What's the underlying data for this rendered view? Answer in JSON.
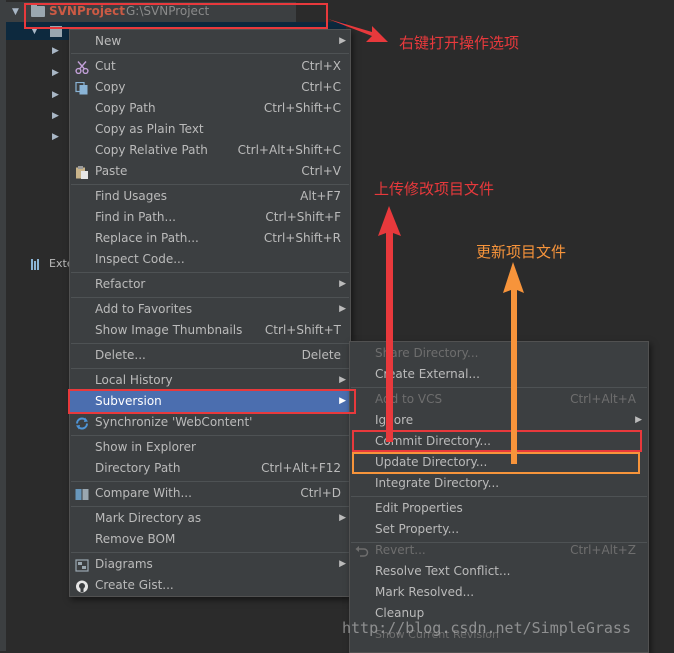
{
  "project": {
    "name": "SVNProject",
    "path": "G:\\SVNProject",
    "ext_label": "Exte"
  },
  "context_menu": {
    "items": [
      {
        "label": "New",
        "shortcut": "",
        "submenu": true
      },
      {
        "label": "Cut",
        "shortcut": "Ctrl+X",
        "icon": "scissors-icon"
      },
      {
        "label": "Copy",
        "shortcut": "Ctrl+C",
        "icon": "copy-icon"
      },
      {
        "label": "Copy Path",
        "shortcut": "Ctrl+Shift+C"
      },
      {
        "label": "Copy as Plain Text",
        "shortcut": ""
      },
      {
        "label": "Copy Relative Path",
        "shortcut": "Ctrl+Alt+Shift+C"
      },
      {
        "label": "Paste",
        "shortcut": "Ctrl+V",
        "icon": "clipboard-icon"
      },
      {
        "label": "Find Usages",
        "shortcut": "Alt+F7"
      },
      {
        "label": "Find in Path...",
        "shortcut": "Ctrl+Shift+F"
      },
      {
        "label": "Replace in Path...",
        "shortcut": "Ctrl+Shift+R"
      },
      {
        "label": "Inspect Code...",
        "shortcut": ""
      },
      {
        "label": "Refactor",
        "shortcut": "",
        "submenu": true
      },
      {
        "label": "Add to Favorites",
        "shortcut": "",
        "submenu": true
      },
      {
        "label": "Show Image Thumbnails",
        "shortcut": "Ctrl+Shift+T"
      },
      {
        "label": "Delete...",
        "shortcut": "Delete"
      },
      {
        "label": "Local History",
        "shortcut": "",
        "submenu": true
      },
      {
        "label": "Subversion",
        "shortcut": "",
        "submenu": true
      },
      {
        "label": "Synchronize 'WebContent'",
        "shortcut": "",
        "icon": "sync-icon"
      },
      {
        "label": "Show in Explorer",
        "shortcut": ""
      },
      {
        "label": "Directory Path",
        "shortcut": "Ctrl+Alt+F12"
      },
      {
        "label": "Compare With...",
        "shortcut": "Ctrl+D",
        "icon": "compare-icon"
      },
      {
        "label": "Mark Directory as",
        "shortcut": "",
        "submenu": true
      },
      {
        "label": "Remove BOM",
        "shortcut": ""
      },
      {
        "label": "Diagrams",
        "shortcut": "",
        "submenu": true,
        "icon": "diagram-icon"
      },
      {
        "label": "Create Gist...",
        "shortcut": "",
        "icon": "github-icon"
      }
    ]
  },
  "subversion_menu": {
    "items": [
      {
        "label": "Share Directory...",
        "shortcut": "",
        "disabled": true
      },
      {
        "label": "Create External...",
        "shortcut": ""
      },
      {
        "label": "Add to VCS",
        "shortcut": "Ctrl+Alt+A",
        "disabled": true
      },
      {
        "label": "Ignore",
        "shortcut": "",
        "submenu": true
      },
      {
        "label": "Commit Directory...",
        "shortcut": ""
      },
      {
        "label": "Update Directory...",
        "shortcut": ""
      },
      {
        "label": "Integrate Directory...",
        "shortcut": ""
      },
      {
        "label": "Edit Properties",
        "shortcut": ""
      },
      {
        "label": "Set Property...",
        "shortcut": ""
      },
      {
        "label": "Revert...",
        "shortcut": "Ctrl+Alt+Z",
        "disabled": true,
        "icon": "revert-icon"
      },
      {
        "label": "Resolve Text Conflict...",
        "shortcut": ""
      },
      {
        "label": "Mark Resolved...",
        "shortcut": ""
      },
      {
        "label": "Cleanup",
        "shortcut": ""
      },
      {
        "label": "Show Current Revision",
        "shortcut": "",
        "disabled": true
      }
    ]
  },
  "annotations": {
    "right_click": "右键打开操作选项",
    "upload": "上传修改项目文件",
    "update": "更新项目文件"
  },
  "watermark": "http://blog.csdn.net/SimpleGrass",
  "colors": {
    "highlight_red": "#e8393c",
    "highlight_orange": "#f7943b",
    "selection_blue": "#4b6eaf",
    "project_name": "#cb5a44"
  }
}
